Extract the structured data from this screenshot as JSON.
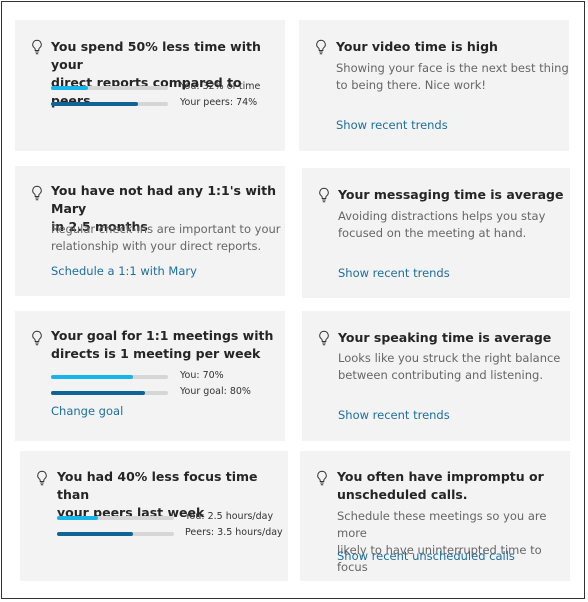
{
  "colors": {
    "bar_you": "#18b5ea",
    "bar_peers": "#0f6395",
    "track": "#d6d6d6",
    "link": "#1d6e9e"
  },
  "cards": [
    {
      "icon": "lightbulb-icon",
      "title_line1": "You spend 50% less time with your",
      "title_line2": "direct reports compared to peers",
      "bars": [
        {
          "label": "You: 32% of time",
          "value": 0.32
        },
        {
          "label": "Your peers: 74%",
          "value": 0.74
        }
      ]
    },
    {
      "icon": "lightbulb-icon",
      "title_line1": "Your video time is high",
      "body_line1": "Showing your face is the next best thing",
      "body_line2": "to being there. Nice work!",
      "link": "Show recent trends"
    },
    {
      "icon": "lightbulb-icon",
      "title_line1": "You have not had any 1:1's with Mary",
      "title_line2": "in 2.5 months",
      "body_line1": "Regular check-ins are important to your",
      "body_line2": "relationship with your direct reports.",
      "link": "Schedule a 1:1 with Mary"
    },
    {
      "icon": "lightbulb-icon",
      "title_line1": "Your messaging time is average",
      "body_line1": "Avoiding distractions helps you stay",
      "body_line2": "focused on the meeting at hand.",
      "link": "Show recent trends"
    },
    {
      "icon": "lightbulb-icon",
      "title_line1": "Your goal for 1:1 meetings with",
      "title_line2": "directs is 1 meeting per week",
      "bars": [
        {
          "label": "You: 70%",
          "value": 0.7
        },
        {
          "label": "Your goal: 80%",
          "value": 0.8
        }
      ],
      "link": "Change goal"
    },
    {
      "icon": "lightbulb-icon",
      "title_line1": "Your speaking time is average",
      "body_line1": "Looks like you struck the right balance",
      "body_line2": "between contributing and listening.",
      "link": "Show recent trends"
    },
    {
      "icon": "lightbulb-icon",
      "title_line1": "You had 40% less focus time than",
      "title_line2": "your peers last week",
      "bars": [
        {
          "label": "You: 2.5 hours/day",
          "value": 0.35
        },
        {
          "label": "Peers: 3.5 hours/day",
          "value": 0.65
        }
      ]
    },
    {
      "icon": "lightbulb-icon",
      "title_line1": "You often have impromptu or",
      "title_line2": "unscheduled calls.",
      "body_line1": "Schedule these meetings so you are more",
      "body_line2": "likely to have uninterrupted time to focus",
      "link": "Show recent unscheduled calls"
    }
  ]
}
